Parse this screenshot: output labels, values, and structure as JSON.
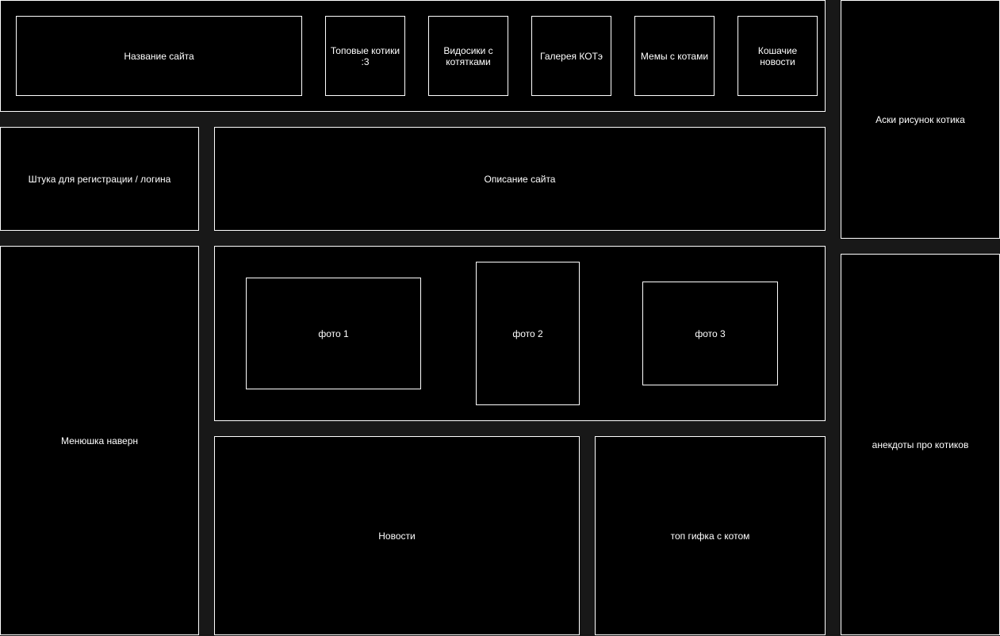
{
  "header": {
    "site_name": "Название сайта",
    "nav": [
      {
        "label": "Топовые котики :3"
      },
      {
        "label": "Видосики с котятками"
      },
      {
        "label": "Галерея КОТэ"
      },
      {
        "label": "Мемы с котами"
      },
      {
        "label": "Кошачие новости"
      }
    ]
  },
  "login": {
    "label": "Штука для регистрации / логина"
  },
  "description": {
    "label": "Описание сайта"
  },
  "menu": {
    "label": "Менюшка наверн"
  },
  "photos": [
    {
      "label": "фото 1"
    },
    {
      "label": "фото 2"
    },
    {
      "label": "фото 3"
    }
  ],
  "news": {
    "label": "Новости"
  },
  "gif": {
    "label": "топ гифка с котом"
  },
  "ascii_cat": {
    "label": "Аски рисунок котика"
  },
  "jokes": {
    "label": "анекдоты про котиков"
  },
  "colors": {
    "background": "#181818",
    "block": "#000000",
    "border": "#ffffff",
    "text": "#ffffff"
  }
}
